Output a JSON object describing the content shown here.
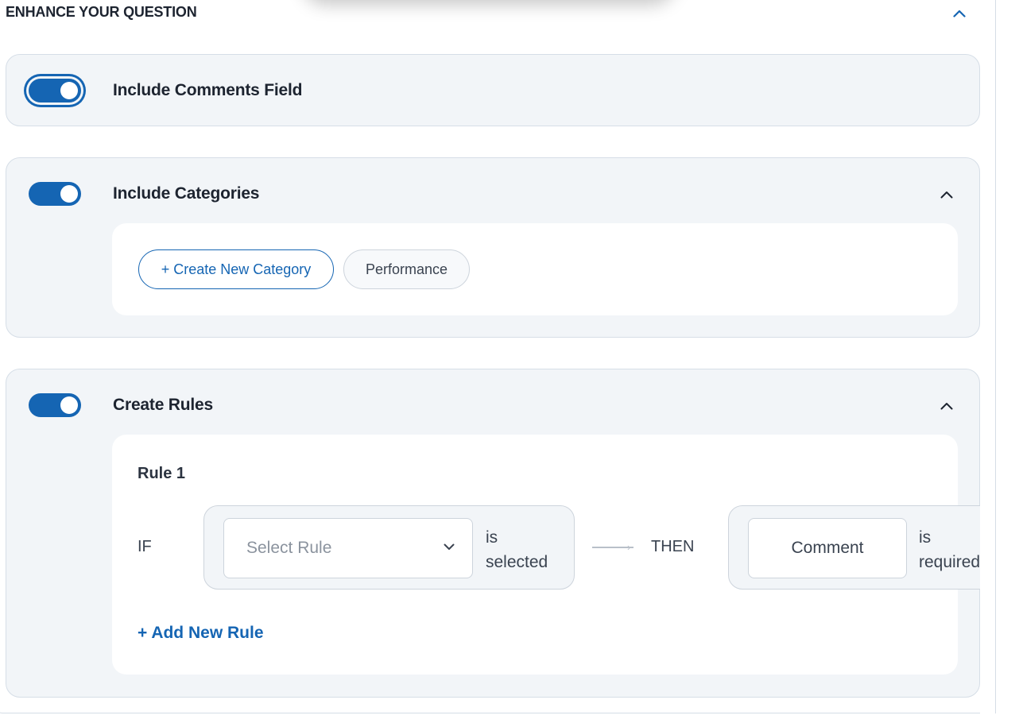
{
  "section": {
    "title": "ENHANCE YOUR QUESTION"
  },
  "panels": {
    "comments": {
      "label": "Include Comments Field",
      "enabled": true
    },
    "categories": {
      "label": "Include Categories",
      "enabled": true,
      "create_button": "+ Create New Category",
      "chips": [
        "Performance"
      ]
    },
    "rules": {
      "label": "Create Rules",
      "enabled": true,
      "rule_title": "Rule 1",
      "if_label": "IF",
      "select_placeholder": "Select Rule",
      "condition_line1": "is",
      "condition_line2": "selected",
      "then_label": "THEN",
      "result_field": "Comment",
      "result_line1": "is",
      "result_line2": "required",
      "add_rule": "+ Add New Rule"
    }
  },
  "colors": {
    "accent": "#1565b3",
    "panel_bg": "#f2f5f8",
    "border": "#d6dee7"
  }
}
